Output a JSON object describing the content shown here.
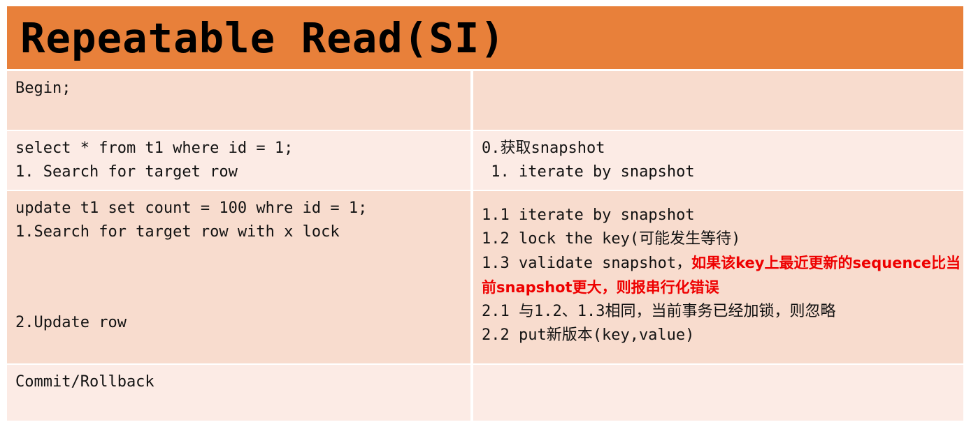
{
  "slide": {
    "title": "Repeatable Read(SI)",
    "header_color": "#E8803A",
    "row_shade_dark": "#F8DCCE",
    "row_shade_light": "#FCEBE5",
    "highlight_color": "#EE0000"
  },
  "rows": [
    {
      "left": {
        "lines": [
          "Begin;"
        ]
      },
      "right": {
        "lines": []
      }
    },
    {
      "left": {
        "lines": [
          "select * from t1 where id = 1;",
          "1. Search for target row"
        ]
      },
      "right": {
        "lines": [
          "0.获取snapshot",
          " 1. iterate by snapshot"
        ]
      }
    },
    {
      "left": {
        "lines": [
          "update t1 set count = 100 whre id = 1;",
          "1.Search for target row with x lock",
          "2.Update row"
        ]
      },
      "right": {
        "lines": [
          "1.1 iterate by snapshot",
          "1.2 lock the key(可能发生等待)",
          "1.3 validate snapshot，",
          "2.1 与1.2、1.3相同，当前事务已经加锁，则忽略",
          "2.2 put新版本(key,value)"
        ],
        "highlight": "如果该key上最近更新的sequence比当前snapshot更大，则报串行化错误"
      }
    },
    {
      "left": {
        "lines": [
          "Commit/Rollback"
        ]
      },
      "right": {
        "lines": []
      }
    }
  ]
}
